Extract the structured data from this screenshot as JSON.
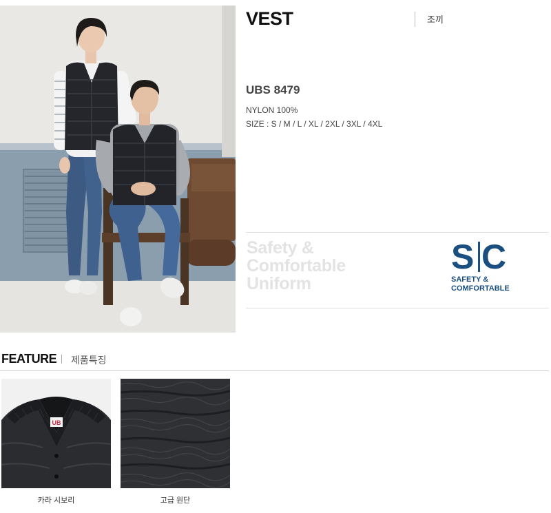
{
  "product": {
    "title": "VEST",
    "title_ko": "조끼",
    "model": "UBS 8479",
    "material": "NYLON 100%",
    "sizes": "SIZE : S / M / L / XL / 2XL / 3XL / 4XL"
  },
  "brand": {
    "slogan_lines": [
      "Safety &",
      "Comfortable",
      "Uniform"
    ],
    "logo_s": "S",
    "logo_c": "C",
    "logo_text_lines": [
      "SAFETY &",
      "COMFORTABLE"
    ],
    "color": "#1a4f80"
  },
  "feature": {
    "title": "FEATURE",
    "title_ko": "제품특징",
    "items": [
      {
        "label": "카라 시보리",
        "tag": "UB"
      },
      {
        "label": "고급 원단"
      }
    ]
  }
}
